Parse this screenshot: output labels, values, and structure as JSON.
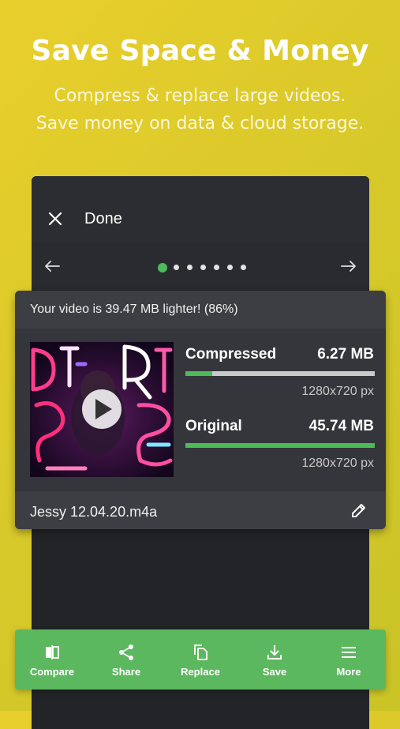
{
  "promo": {
    "title": "Save Space & Money",
    "subtitle_line1": "Compress & replace large videos.",
    "subtitle_line2": "Save money on data &  cloud storage."
  },
  "appbar": {
    "title": "Done",
    "close_icon": "close-icon"
  },
  "pager": {
    "total": 7,
    "active_index": 0
  },
  "result": {
    "banner": "Your video is 39.47 MB lighter! (86%)",
    "compressed": {
      "label": "Compressed",
      "size": "6.27 MB",
      "resolution": "1280x720 px",
      "fraction": 0.14
    },
    "original": {
      "label": "Original",
      "size": "45.74 MB",
      "resolution": "1280x720 px",
      "fraction": 1.0
    },
    "filename": "Jessy 12.04.20.m4a"
  },
  "actions": [
    {
      "label": "Compare",
      "icon": "compare-icon"
    },
    {
      "label": "Share",
      "icon": "share-icon"
    },
    {
      "label": "Replace",
      "icon": "replace-icon"
    },
    {
      "label": "Save",
      "icon": "save-icon"
    },
    {
      "label": "More",
      "icon": "menu-icon"
    }
  ],
  "colors": {
    "accent": "#4cbb5a",
    "background": "#e3cc2b",
    "surface": "#232428"
  }
}
